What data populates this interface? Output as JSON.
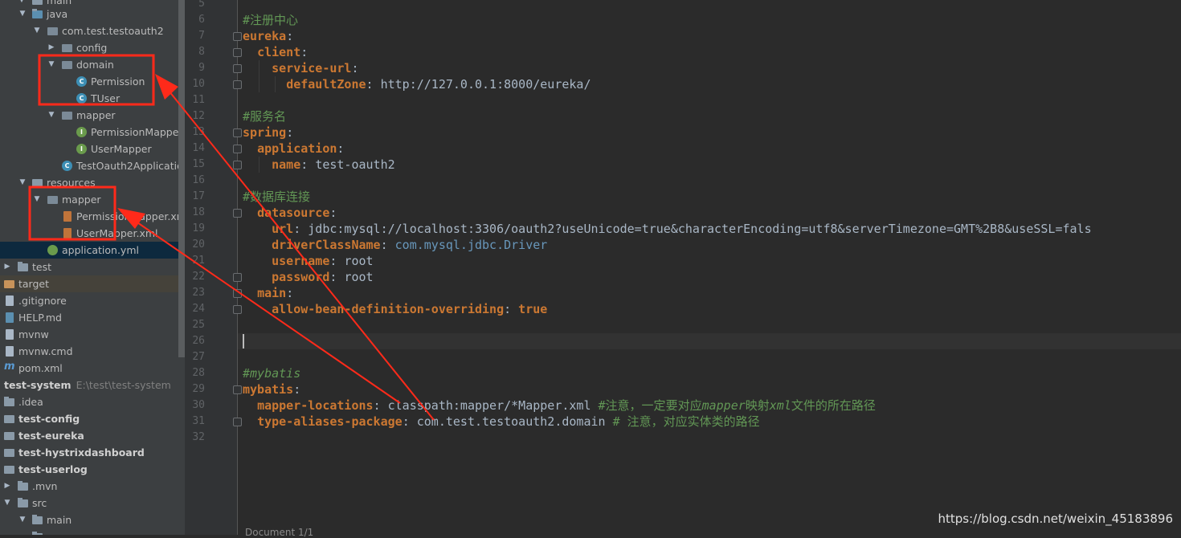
{
  "tree": {
    "rows": [
      {
        "label": "main",
        "kind": "folder"
      },
      {
        "label": "java",
        "kind": "folder-src"
      },
      {
        "label": "com.test.testoauth2",
        "kind": "package"
      },
      {
        "label": "config",
        "kind": "package"
      },
      {
        "label": "domain",
        "kind": "package"
      },
      {
        "label": "Permission",
        "kind": "class"
      },
      {
        "label": "TUser",
        "kind": "class"
      },
      {
        "label": "mapper",
        "kind": "package"
      },
      {
        "label": "PermissionMapper",
        "kind": "interface"
      },
      {
        "label": "UserMapper",
        "kind": "interface"
      },
      {
        "label": "TestOauth2Application",
        "kind": "spring-class"
      },
      {
        "label": "resources",
        "kind": "folder-res"
      },
      {
        "label": "mapper",
        "kind": "folder"
      },
      {
        "label": "PermissionMapper.xml",
        "kind": "xml"
      },
      {
        "label": "UserMapper.xml",
        "kind": "xml"
      },
      {
        "label": "application.yml",
        "kind": "yml"
      },
      {
        "label": "test",
        "kind": "folder"
      },
      {
        "label": "target",
        "kind": "folder-target"
      },
      {
        "label": ".gitignore",
        "kind": "file"
      },
      {
        "label": "HELP.md",
        "kind": "md"
      },
      {
        "label": "mvnw",
        "kind": "file"
      },
      {
        "label": "mvnw.cmd",
        "kind": "file"
      },
      {
        "label": "pom.xml",
        "kind": "maven"
      },
      {
        "label": "test-system",
        "kind": "module",
        "path": "E:\\test\\test-system"
      },
      {
        "label": ".idea",
        "kind": "folder"
      },
      {
        "label": "test-config",
        "kind": "module"
      },
      {
        "label": "test-eureka",
        "kind": "module"
      },
      {
        "label": "test-hystrixdashboard",
        "kind": "module"
      },
      {
        "label": "test-userlog",
        "kind": "module"
      },
      {
        "label": ".mvn",
        "kind": "folder"
      },
      {
        "label": "src",
        "kind": "folder"
      },
      {
        "label": "main",
        "kind": "folder"
      }
    ]
  },
  "editor": {
    "line_numbers": [
      "5",
      "6",
      "7",
      "8",
      "9",
      "10",
      "11",
      "12",
      "13",
      "14",
      "15",
      "16",
      "17",
      "18",
      "19",
      "20",
      "21",
      "22",
      "23",
      "24",
      "25",
      "26",
      "27",
      "28",
      "29",
      "30",
      "31",
      "32"
    ],
    "lines": {
      "l6": "#注册中心",
      "l7_key": "eureka",
      "l8_key": "client",
      "l9_key": "service-url",
      "l10_key": "defaultZone",
      "l10_val": "http://127.0.0.1:8000/eureka/",
      "l12": "#服务名",
      "l13_key": "spring",
      "l14_key": "application",
      "l15_key": "name",
      "l15_val": "test-oauth2",
      "l17": "#数据库连接",
      "l18_key": "datasource",
      "l19_key": "url",
      "l19_val": "jdbc:mysql://localhost:3306/oauth2?useUnicode=true&characterEncoding=utf8&serverTimezone=GMT%2B8&useSSL=fals",
      "l20_key": "driverClassName",
      "l20_val": "com.mysql.jdbc.Driver",
      "l21_key": "username",
      "l21_val": "root",
      "l22_key": "password",
      "l22_val": "root",
      "l23_key": "main",
      "l24_key": "allow-bean-definition-overriding",
      "l24_val": "true",
      "l28": "#mybatis",
      "l29_key": "mybatis",
      "l30_key": "mapper-locations",
      "l30_val": "classpath:mapper/*Mapper.xml",
      "l30_comment_a": "#注意，一定要对应",
      "l30_comment_b": "mapper",
      "l30_comment_c": "映射",
      "l30_comment_d": "xml",
      "l30_comment_e": "文件的所在路径",
      "l31_key": "type-aliases-package",
      "l31_val": "com.test.testoauth2.domain",
      "l31_comment": "# 注意，对应实体类的路径"
    },
    "status_fragment": "Document 1/1"
  },
  "watermark": "https://blog.csdn.net/weixin_45183896",
  "colors": {
    "annotation": "#ff2a1a",
    "key": "#cc7832",
    "comment": "#629755",
    "text": "#a9b7c6",
    "selection": "#0d293e"
  }
}
